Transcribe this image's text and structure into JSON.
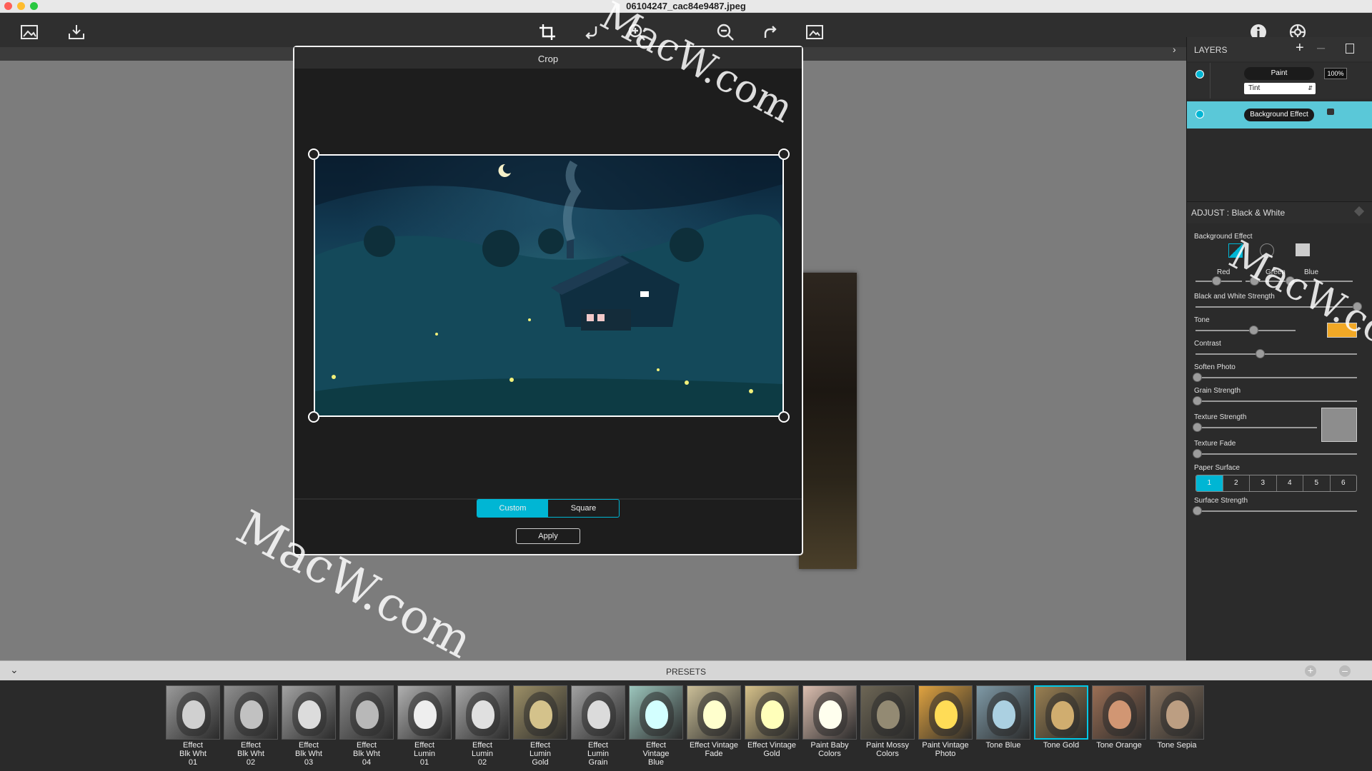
{
  "window": {
    "title": "06104247_cac84e9487.jpeg"
  },
  "crop_dialog": {
    "title": "Crop",
    "ratio_options": [
      {
        "label": "Custom",
        "selected": true
      },
      {
        "label": "Square",
        "selected": false
      }
    ],
    "apply_label": "Apply"
  },
  "layers": {
    "title": "LAYERS",
    "items": [
      {
        "name": "Paint",
        "opacity": "100%",
        "mode": "Tint"
      },
      {
        "name": "Background Effect"
      }
    ]
  },
  "adjust": {
    "title": "ADJUST : Black & White",
    "section": "Background Effect",
    "channel_labels": [
      "Red",
      "Green",
      "Blue"
    ],
    "sliders": {
      "bw_strength": "Black and White Strength",
      "tone": "Tone",
      "contrast": "Contrast",
      "soften": "Soften Photo",
      "grain": "Grain Strength",
      "texture_strength": "Texture Strength",
      "texture_fade": "Texture Fade",
      "paper_surface": "Paper Surface",
      "surface_strength": "Surface Strength"
    },
    "paper_options": [
      "1",
      "2",
      "3",
      "4",
      "5",
      "6"
    ],
    "paper_selected": "1",
    "tone_color": "#f1a826",
    "accent": "#00b6d4"
  },
  "presets": {
    "title": "PRESETS",
    "items": [
      {
        "label": "Effect\nBlk Wht\n01",
        "tint": "#9a9a9a"
      },
      {
        "label": "Effect\nBlk Wht\n02",
        "tint": "#8f8f8f"
      },
      {
        "label": "Effect\nBlk Wht\n03",
        "tint": "#a3a3a3"
      },
      {
        "label": "Effect\nBlk Wht\n04",
        "tint": "#888888"
      },
      {
        "label": "Effect\nLumin\n01",
        "tint": "#b0b0b0"
      },
      {
        "label": "Effect\nLumin\n02",
        "tint": "#a6a6a6"
      },
      {
        "label": "Effect\nLumin\nGold",
        "tint": "#9d9067"
      },
      {
        "label": "Effect\nLumin\nGrain",
        "tint": "#a2a2a2"
      },
      {
        "label": "Effect\nVintage\nBlue",
        "tint": "#9cc6bd"
      },
      {
        "label": "Effect Vintage\nFade",
        "tint": "#cbbf98"
      },
      {
        "label": "Effect Vintage\nGold",
        "tint": "#d6c18a"
      },
      {
        "label": "Paint Baby\nColors",
        "tint": "#dcbfb0"
      },
      {
        "label": "Paint Mossy\nColors",
        "tint": "#6d6655"
      },
      {
        "label": "Paint Vintage\nPhoto",
        "tint": "#e0a340"
      },
      {
        "label": "Tone Blue",
        "tint": "#7f9aa7"
      },
      {
        "label": "Tone Gold",
        "tint": "#9a8052"
      },
      {
        "label": "Tone Orange",
        "tint": "#9b6f55"
      },
      {
        "label": "Tone Sepia",
        "tint": "#8b7560"
      }
    ],
    "selected": "Tone Gold"
  },
  "icons": {
    "toolbar": [
      "open-image-icon",
      "export-icon",
      "crop-icon",
      "undo-icon",
      "zoom-in-icon",
      "zoom-out-icon",
      "redo-icon",
      "compare-icon",
      "info-icon",
      "settings-icon"
    ]
  },
  "watermark": "MacW.com"
}
